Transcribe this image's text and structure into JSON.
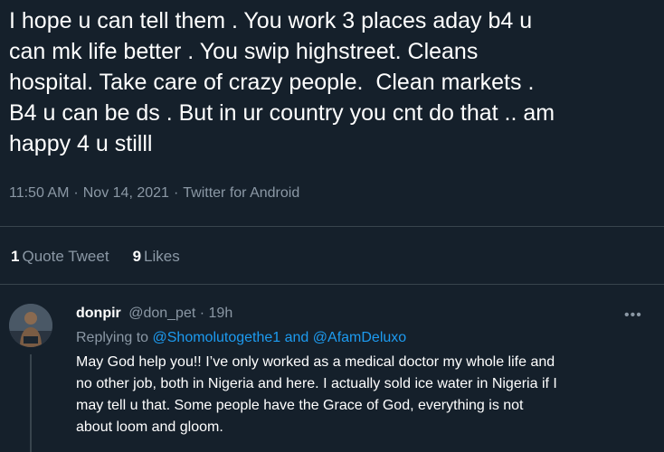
{
  "tweet": {
    "text": "I hope u can tell them . You work 3 places aday b4 u\ncan mk life better . You swip highstreet. Cleans\nhospital. Take care of crazy people.  Clean markets .\nB4 u can be ds . But in ur country you cnt do that .. am\nhappy 4 u stilll",
    "time": "11:50 AM",
    "date": "Nov 14, 2021",
    "source": "Twitter for Android",
    "separator": "·"
  },
  "stats": {
    "quote_count": "1",
    "quote_label": "Quote Tweet",
    "like_count": "9",
    "like_label": "Likes"
  },
  "reply": {
    "display_name": "donpir",
    "handle": "@don_pet",
    "separator": "·",
    "age": "19h",
    "replying_prefix": "Replying to",
    "mention_1": "@Shomolutogethe1",
    "and": "and",
    "mention_2": "@AfamDeluxo",
    "text": "May God help you!! I’ve only worked as a medical doctor my whole life and\nno other job, both in Nigeria and here. I actually sold ice water in Nigeria if I\nmay tell u that. Some people have the Grace of God, everything is not\nabout loom and gloom.",
    "more_icon": "more-horizontal-icon"
  },
  "colors": {
    "background": "#15202b",
    "secondary_text": "#8b98a5",
    "link": "#1d9bf0",
    "divider": "#38444d"
  }
}
